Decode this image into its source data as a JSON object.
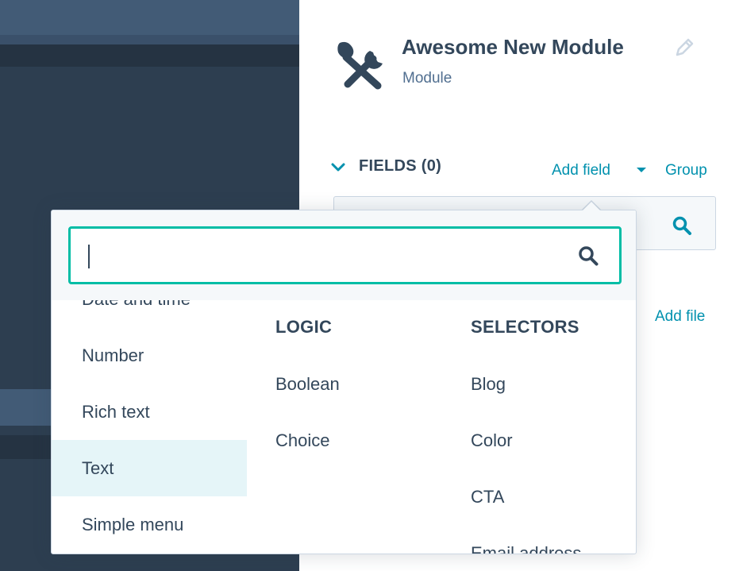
{
  "module": {
    "title": "Awesome New Module",
    "subtitle": "Module",
    "icon": "tools-icon"
  },
  "fields_section": {
    "label": "FIELDS (0)",
    "add_field_label": "Add field",
    "group_label": "Group",
    "add_file_label": "Add file"
  },
  "field_picker": {
    "search_value": "",
    "columns": {
      "basic": {
        "items": [
          "Date and time",
          "Number",
          "Rich text",
          "Text",
          "Simple menu"
        ],
        "highlighted": "Text"
      },
      "logic": {
        "header": "LOGIC",
        "items": [
          "Boolean",
          "Choice"
        ]
      },
      "selectors": {
        "header": "SELECTORS",
        "items": [
          "Blog",
          "Color",
          "CTA",
          "Email address"
        ]
      }
    }
  },
  "colors": {
    "accent_link": "#0091ae",
    "focus_border": "#00bda5",
    "dark_panel": "#2d3e50",
    "highlight_row": "#e5f5f8"
  }
}
